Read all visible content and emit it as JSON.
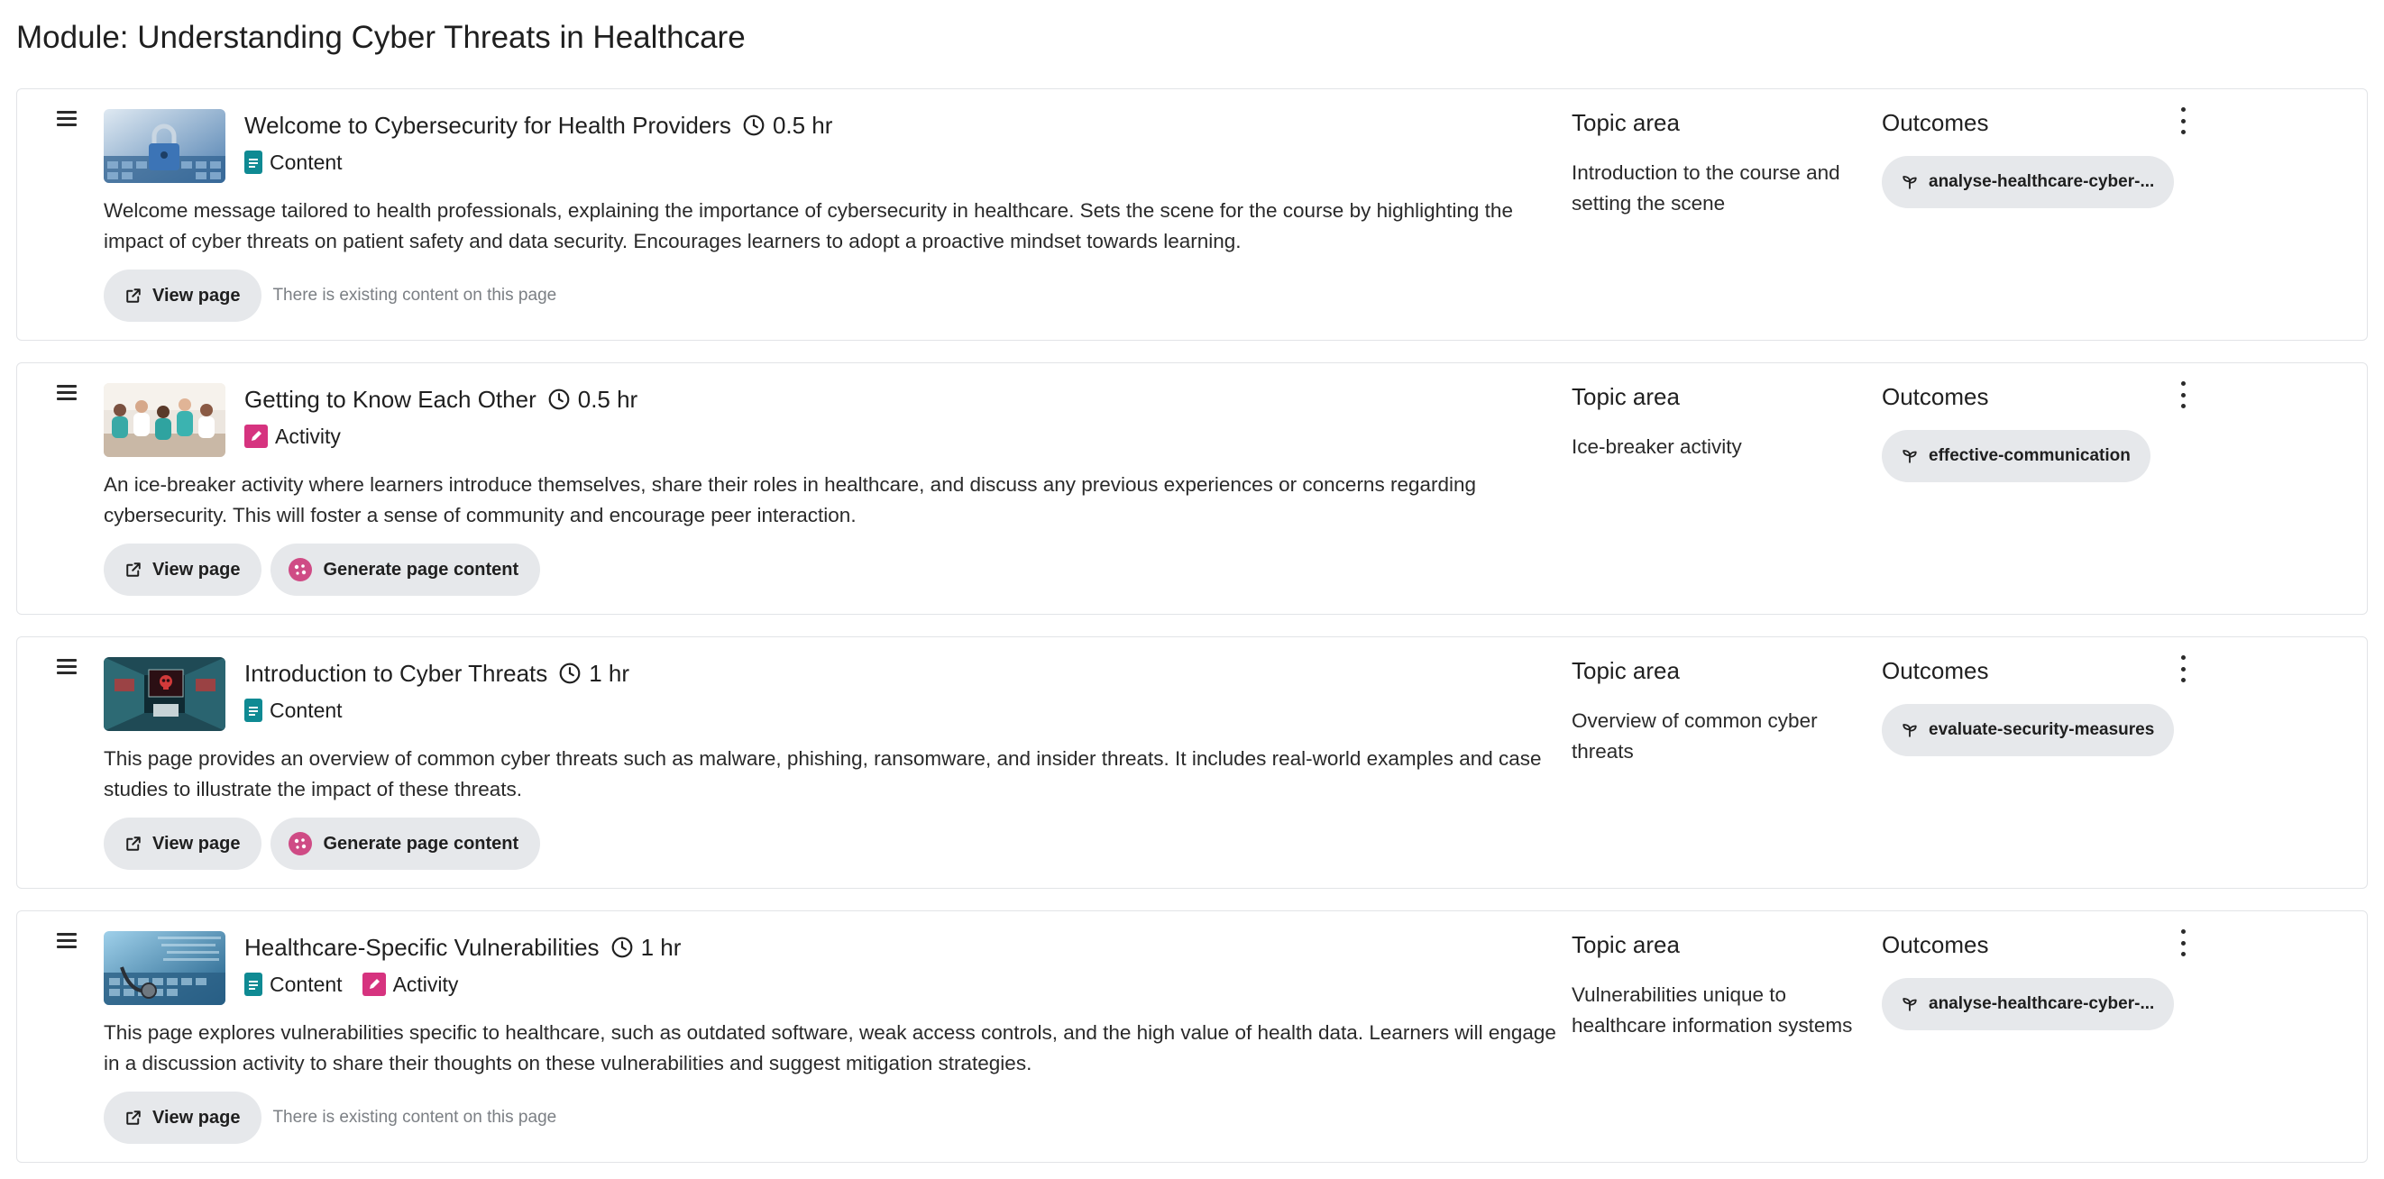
{
  "module": {
    "title": "Module: Understanding Cyber Threats in Healthcare"
  },
  "labels": {
    "topic_area": "Topic area",
    "outcomes": "Outcomes",
    "view_page": "View page",
    "generate_page_content": "Generate page content",
    "existing_content_note": "There is existing content on this page"
  },
  "colors": {
    "content_icon": "#0f8a93",
    "activity_icon": "#d6337f",
    "chip_background": "#e6e8eb"
  },
  "items": [
    {
      "title": "Welcome to Cybersecurity for Health Providers",
      "duration": "0.5 hr",
      "types": [
        "Content"
      ],
      "thumbnail": "padlock-on-keyboard-image",
      "description": "Welcome message tailored to health professionals, explaining the importance of cybersecurity in healthcare. Sets the scene for the course by highlighting the impact of cyber threats on patient safety and data security. Encourages learners to adopt a proactive mindset towards learning.",
      "topic_area": "Introduction to the course and setting the scene",
      "outcome": "analyse-healthcare-cyber-...",
      "actions": [
        "View page"
      ],
      "note": "There is existing content on this page"
    },
    {
      "title": "Getting to Know Each Other",
      "duration": "0.5 hr",
      "types": [
        "Activity"
      ],
      "thumbnail": "group-of-health-workers-image",
      "description": "An ice-breaker activity where learners introduce themselves, share their roles in healthcare, and discuss any previous experiences or concerns regarding cybersecurity. This will foster a sense of community and encourage peer interaction.",
      "topic_area": "Ice-breaker activity",
      "outcome": "effective-communication",
      "actions": [
        "View page",
        "Generate page content"
      ],
      "note": ""
    },
    {
      "title": "Introduction to Cyber Threats",
      "duration": "1 hr",
      "types": [
        "Content"
      ],
      "thumbnail": "hospital-corridor-skull-screen-image",
      "description": "This page provides an overview of common cyber threats such as malware, phishing, ransomware, and insider threats. It includes real-world examples and case studies to illustrate the impact of these threats.",
      "topic_area": "Overview of common cyber threats",
      "outcome": "evaluate-security-measures",
      "actions": [
        "View page",
        "Generate page content"
      ],
      "note": ""
    },
    {
      "title": "Healthcare-Specific Vulnerabilities",
      "duration": "1 hr",
      "types": [
        "Content",
        "Activity"
      ],
      "thumbnail": "stethoscope-on-keyboard-image",
      "description": "This page explores vulnerabilities specific to healthcare, such as outdated software, weak access controls, and the high value of health data. Learners will engage in a discussion activity to share their thoughts on these vulnerabilities and suggest mitigation strategies.",
      "topic_area": "Vulnerabilities unique to healthcare information systems",
      "outcome": "analyse-healthcare-cyber-...",
      "actions": [
        "View page"
      ],
      "note": "There is existing content on this page"
    }
  ]
}
